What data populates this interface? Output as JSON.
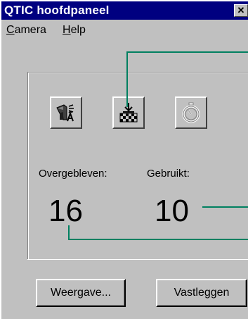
{
  "window": {
    "title": "QTIC hoofdpaneel",
    "close_glyph": "✕"
  },
  "menu": {
    "camera_accel": "C",
    "camera_rest": "amera",
    "help_accel": "H",
    "help_rest": "elp"
  },
  "toolbar": {
    "icons": [
      "camera-settings-icon",
      "capture-download-icon",
      "timer-icon"
    ],
    "timer_enabled": false
  },
  "counters": {
    "remaining_label": "Overgebleven:",
    "remaining_value": "16",
    "used_label": "Gebruikt:",
    "used_value": "10"
  },
  "buttons": {
    "view_label": "Weergave...",
    "capture_label": "Vastleggen"
  },
  "colors": {
    "titlebar": "#000080",
    "face": "#c0c0c0",
    "callout": "#008060"
  }
}
